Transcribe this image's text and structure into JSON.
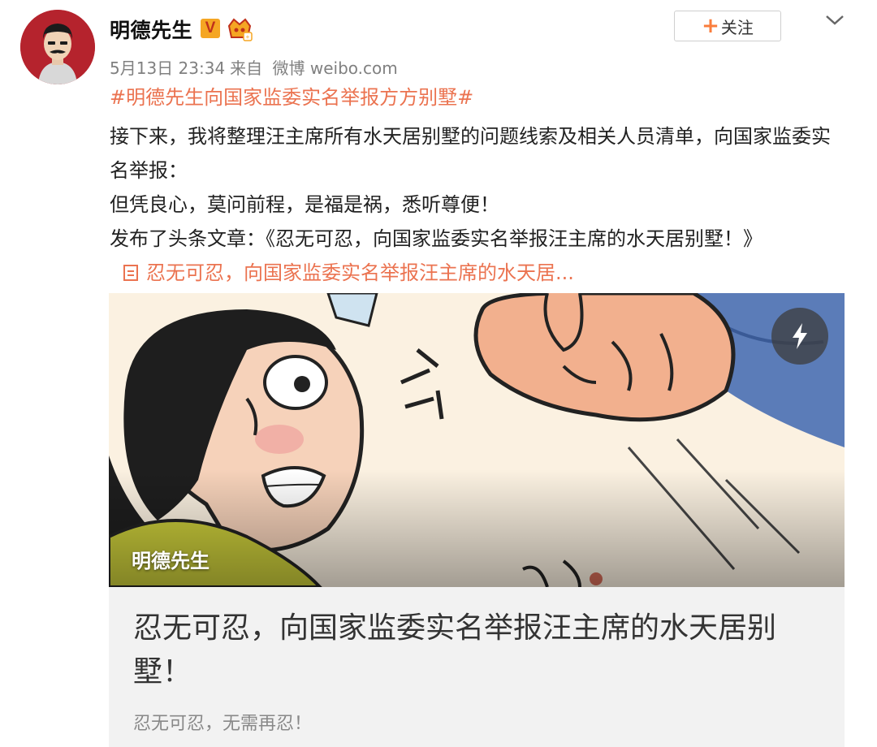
{
  "post": {
    "username": "明德先生",
    "verified_badge": "V",
    "member_icon": "crown-member-icon",
    "follow_label": "关注",
    "follow_icon": "plus-icon",
    "more_icon": "chevron-down-icon",
    "meta": {
      "date": "5月13日 23:34",
      "source_prefix": "来自",
      "source": "微博 weibo.com"
    },
    "hashtag": "#明德先生向国家监委实名举报方方别墅#",
    "paragraphs": [
      "接下来，我将整理汪主席所有水天居别墅的问题线索及相关人员清单，向国家监委实名举报：",
      "但凭良心，莫问前程，是福是祸，悉听尊便！",
      "发布了头条文章：《忍无可忍，向国家监委实名举报汪主席的水天居别墅！》"
    ],
    "article_link": "忍无可忍，向国家监委实名举报汪主席的水天居..."
  },
  "card": {
    "cover_label": "明德先生",
    "flash_icon": "lightning-icon",
    "title": "忍无可忍，向国家监委实名举报汪主席的水天居别墅！",
    "summary": "忍无可忍，无需再忍！"
  },
  "colors": {
    "accent_orange": "#eb7350",
    "follow_plus": "#fa7d3c",
    "avatar_bg": "#b5232d",
    "verified_gold": "#f5a623"
  }
}
